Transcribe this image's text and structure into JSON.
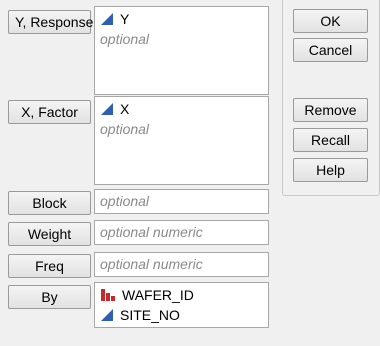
{
  "roles": {
    "y": {
      "label": "Y, Response",
      "items": [
        {
          "name": "Y",
          "icon": "continuous-icon"
        }
      ],
      "placeholder": "optional"
    },
    "x": {
      "label": "X, Factor",
      "items": [
        {
          "name": "X",
          "icon": "continuous-icon"
        }
      ],
      "placeholder": "optional"
    },
    "block": {
      "label": "Block",
      "placeholder": "optional"
    },
    "weight": {
      "label": "Weight",
      "placeholder": "optional numeric"
    },
    "freq": {
      "label": "Freq",
      "placeholder": "optional numeric"
    },
    "by": {
      "label": "By",
      "items": [
        {
          "name": "WAFER_ID",
          "icon": "nominal-icon"
        },
        {
          "name": "SITE_NO",
          "icon": "continuous-icon"
        }
      ]
    }
  },
  "actions": {
    "ok": "OK",
    "cancel": "Cancel",
    "remove": "Remove",
    "recall": "Recall",
    "help": "Help"
  },
  "colors": {
    "continuous_icon": "#2f5fb0",
    "nominal_icon": "#c8282a"
  }
}
